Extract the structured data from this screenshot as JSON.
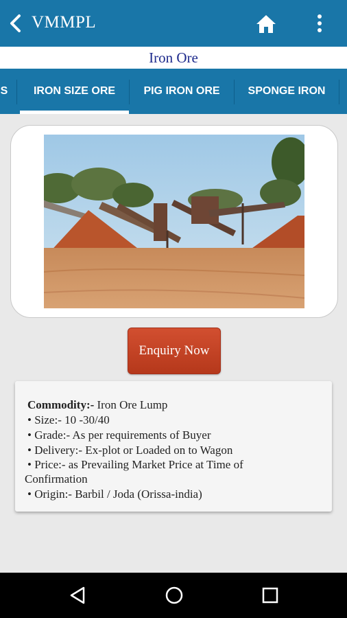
{
  "appbar": {
    "title": "VMMPL",
    "icons": [
      "back-arrow-icon",
      "home-icon",
      "more-vert-icon"
    ],
    "color": "#1976a8"
  },
  "subtitle": "Iron Ore",
  "tabs": [
    {
      "label": "S",
      "active": false
    },
    {
      "label": "IRON SIZE ORE",
      "active": true
    },
    {
      "label": "PIG IRON ORE",
      "active": false
    },
    {
      "label": "SPONGE IRON",
      "active": false
    }
  ],
  "image": {
    "alt": "iron-ore-crushing-site"
  },
  "enquiry_button": {
    "label": "Enquiry Now",
    "color": "#c2432a"
  },
  "details": {
    "commodity_label": "Commodity:-",
    "commodity_value": " Iron Ore Lump",
    "size": "• Size:- 10 -30/40",
    "grade": "• Grade:- As per requirements of Buyer",
    "delivery": "• Delivery:- Ex-plot or Loaded on to Wagon",
    "price_line1": "• Price:- as Prevailing Market Price at Time of",
    "price_line2": "Confirmation",
    "origin": "• Origin:- Barbil / Joda (Orissa-india)"
  },
  "navbar": {
    "icons": [
      "nav-back-icon",
      "nav-home-icon",
      "nav-recents-icon"
    ]
  }
}
